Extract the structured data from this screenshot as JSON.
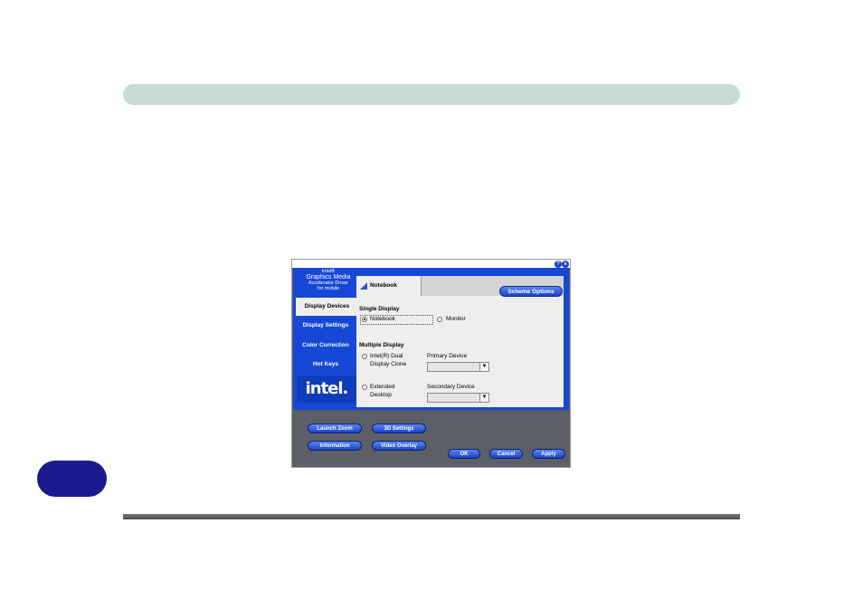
{
  "dialog": {
    "help_glyph": "?",
    "close_glyph": "x",
    "logo_text": [
      "Intel®",
      "Graphics Media",
      "Accelerator Driver",
      "for mobile"
    ],
    "sidebar": [
      "Display Devices",
      "Display Settings",
      "Color Correction",
      "Hot Keys"
    ],
    "intel_logo": "intel.",
    "tab_label": "Notebook",
    "scheme_options": "Scheme Options",
    "single_display": {
      "heading": "Single Display",
      "opt_notebook": "Notebook",
      "opt_monitor": "Monitor"
    },
    "multiple_display": {
      "heading": "Multiple Display",
      "opt_clone_1": "Intel(R) Dual",
      "opt_clone_2": "Display Clone",
      "opt_ext_1": "Extended",
      "opt_ext_2": "Desktop",
      "primary_device": "Primary Device",
      "secondary_device": "Secondary Device"
    },
    "buttons": {
      "launch_zoom": "Launch Zoom",
      "settings_3d": "3D Settings",
      "information": "Information",
      "video_overlay": "Video Overlay",
      "ok": "OK",
      "cancel": "Cancel",
      "apply": "Apply"
    }
  }
}
